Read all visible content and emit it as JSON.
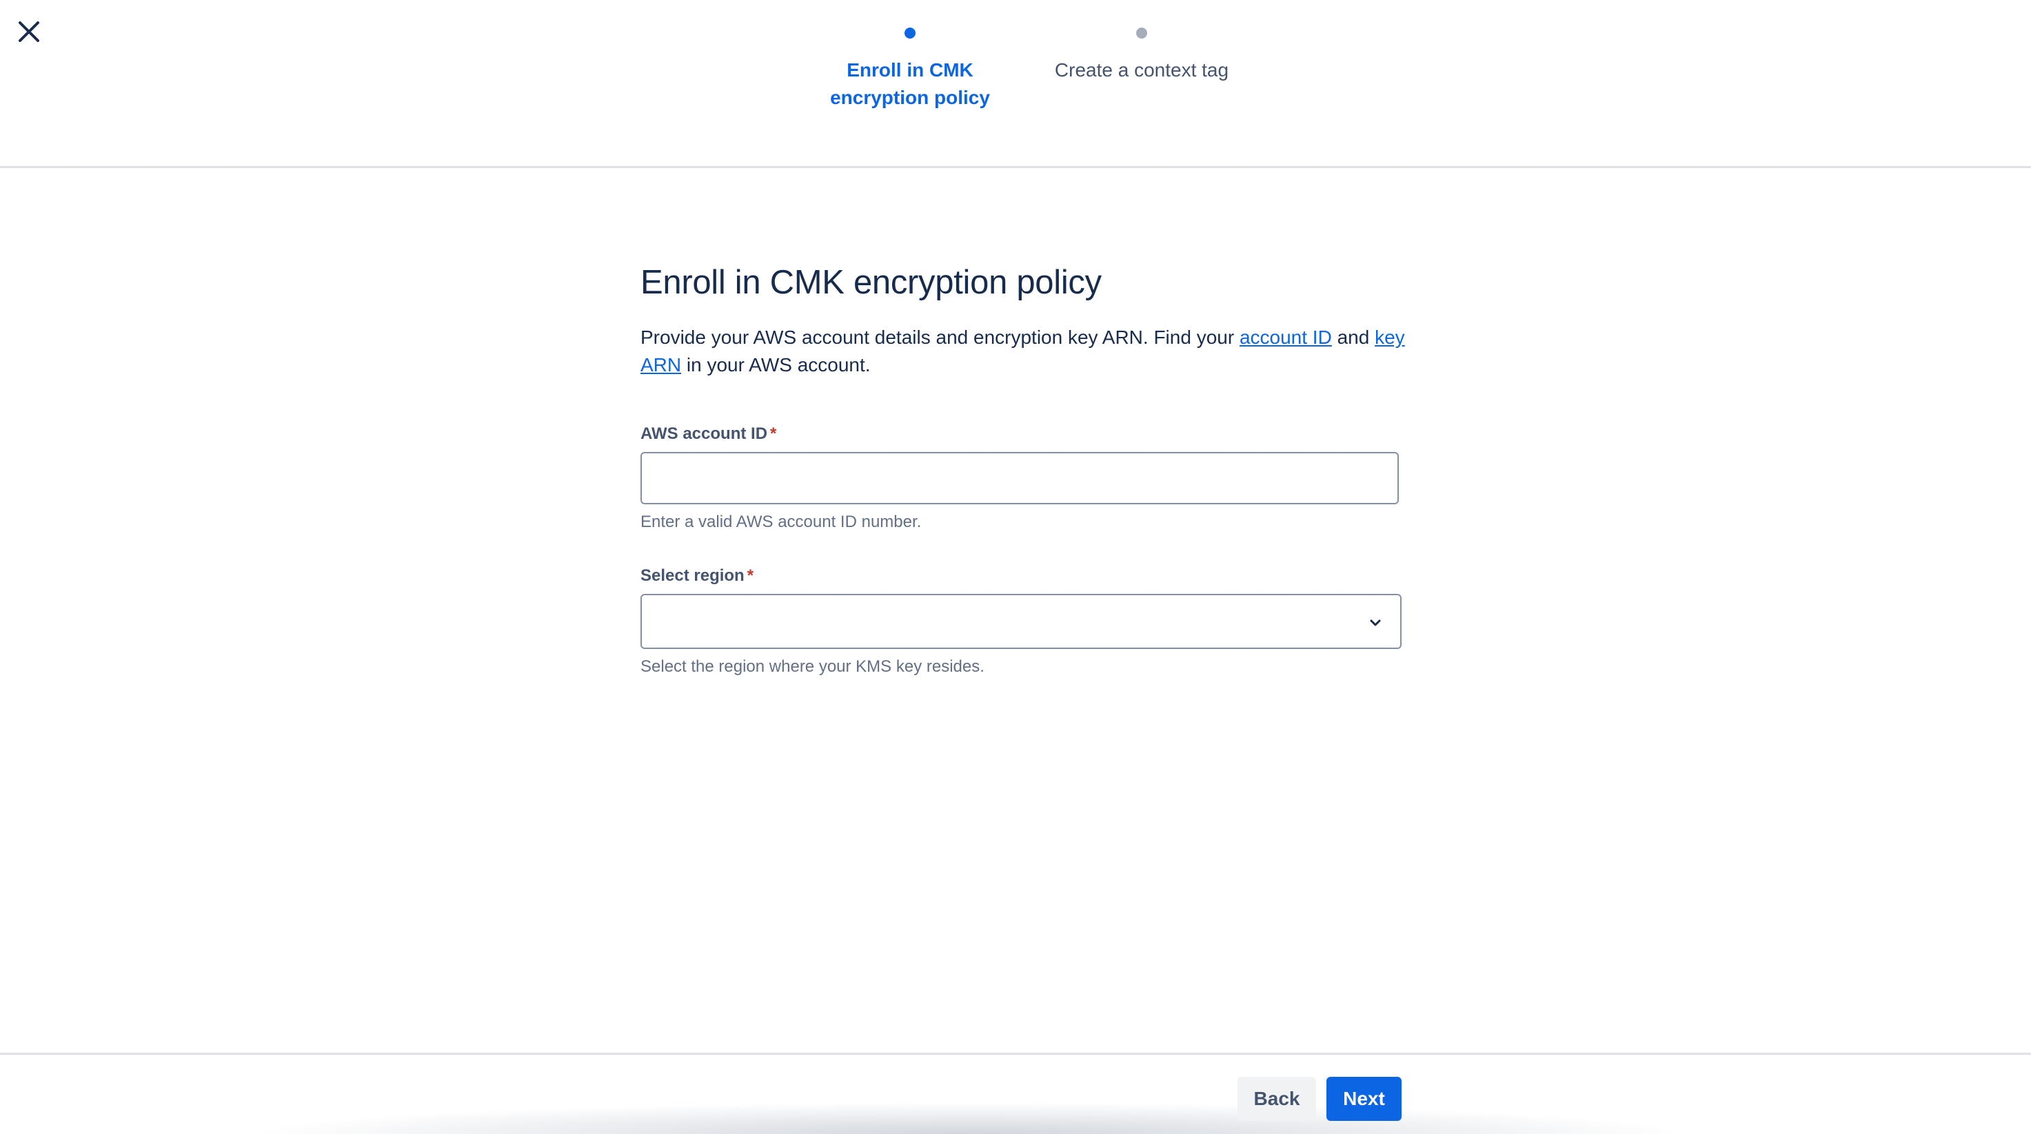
{
  "stepper": {
    "steps": [
      {
        "label": "Enroll in CMK encryption policy",
        "state": "active"
      },
      {
        "label": "Create a context tag",
        "state": "pending"
      }
    ]
  },
  "form": {
    "title": "Enroll in CMK encryption policy",
    "description_prefix": "Provide your AWS account details and encryption key ARN. Find your",
    "account_id_link": "account ID",
    "description_and": "and",
    "key_arn_link": "key ARN",
    "description_suffix": "in your AWS account.",
    "account_id_field": {
      "label": "AWS account ID",
      "required_marker": "*",
      "value": "",
      "helper": "Enter a valid AWS account ID number."
    },
    "region_field": {
      "label": "Select region",
      "required_marker": "*",
      "value": "",
      "helper": "Select the region where your KMS key resides."
    }
  },
  "footer": {
    "back_label": "Back",
    "next_label": "Next"
  },
  "icons": {
    "close": "close-icon",
    "select": "chevron-down-icon"
  },
  "colors": {
    "accent": "#0c66e4",
    "required": "#c9372c",
    "text": "#172b4d"
  }
}
